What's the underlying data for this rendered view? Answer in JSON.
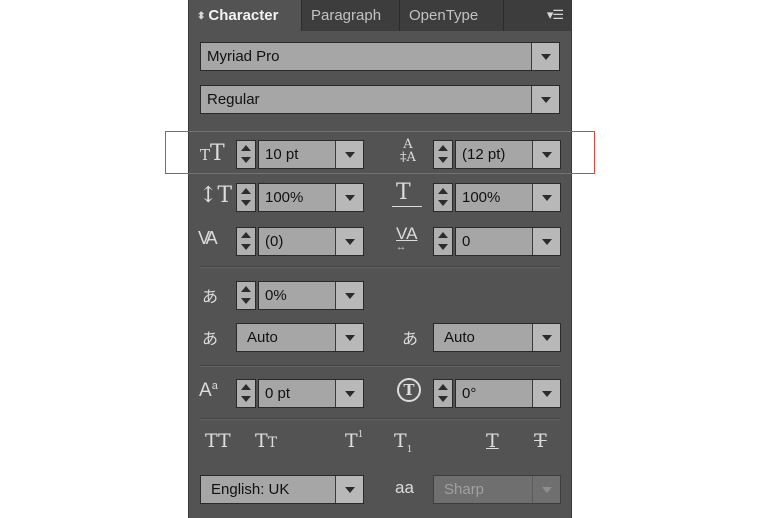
{
  "tabs": [
    {
      "label": "Character",
      "active": true
    },
    {
      "label": "Paragraph",
      "active": false
    },
    {
      "label": "OpenType",
      "active": false
    }
  ],
  "font_family": "Myriad Pro",
  "font_style": "Regular",
  "font_size": "10 pt",
  "leading": "(12 pt)",
  "vertical_scale": "100%",
  "horizontal_scale": "100%",
  "kerning": "(0)",
  "tracking": "0",
  "tsume": "0%",
  "insert_space_left": "Auto",
  "insert_space_right": "Auto",
  "baseline_shift": "0 pt",
  "character_rotation": "0°",
  "language": "English: UK",
  "anti_aliasing": "Sharp",
  "anti_aliasing_icon": "aa",
  "style_buttons": [
    "TT",
    "Tt",
    "T¹",
    "T₁",
    "T",
    "T"
  ],
  "colors": {
    "panel": "#535353",
    "field": "#a6a6a6",
    "highlight": "#e0453d"
  }
}
